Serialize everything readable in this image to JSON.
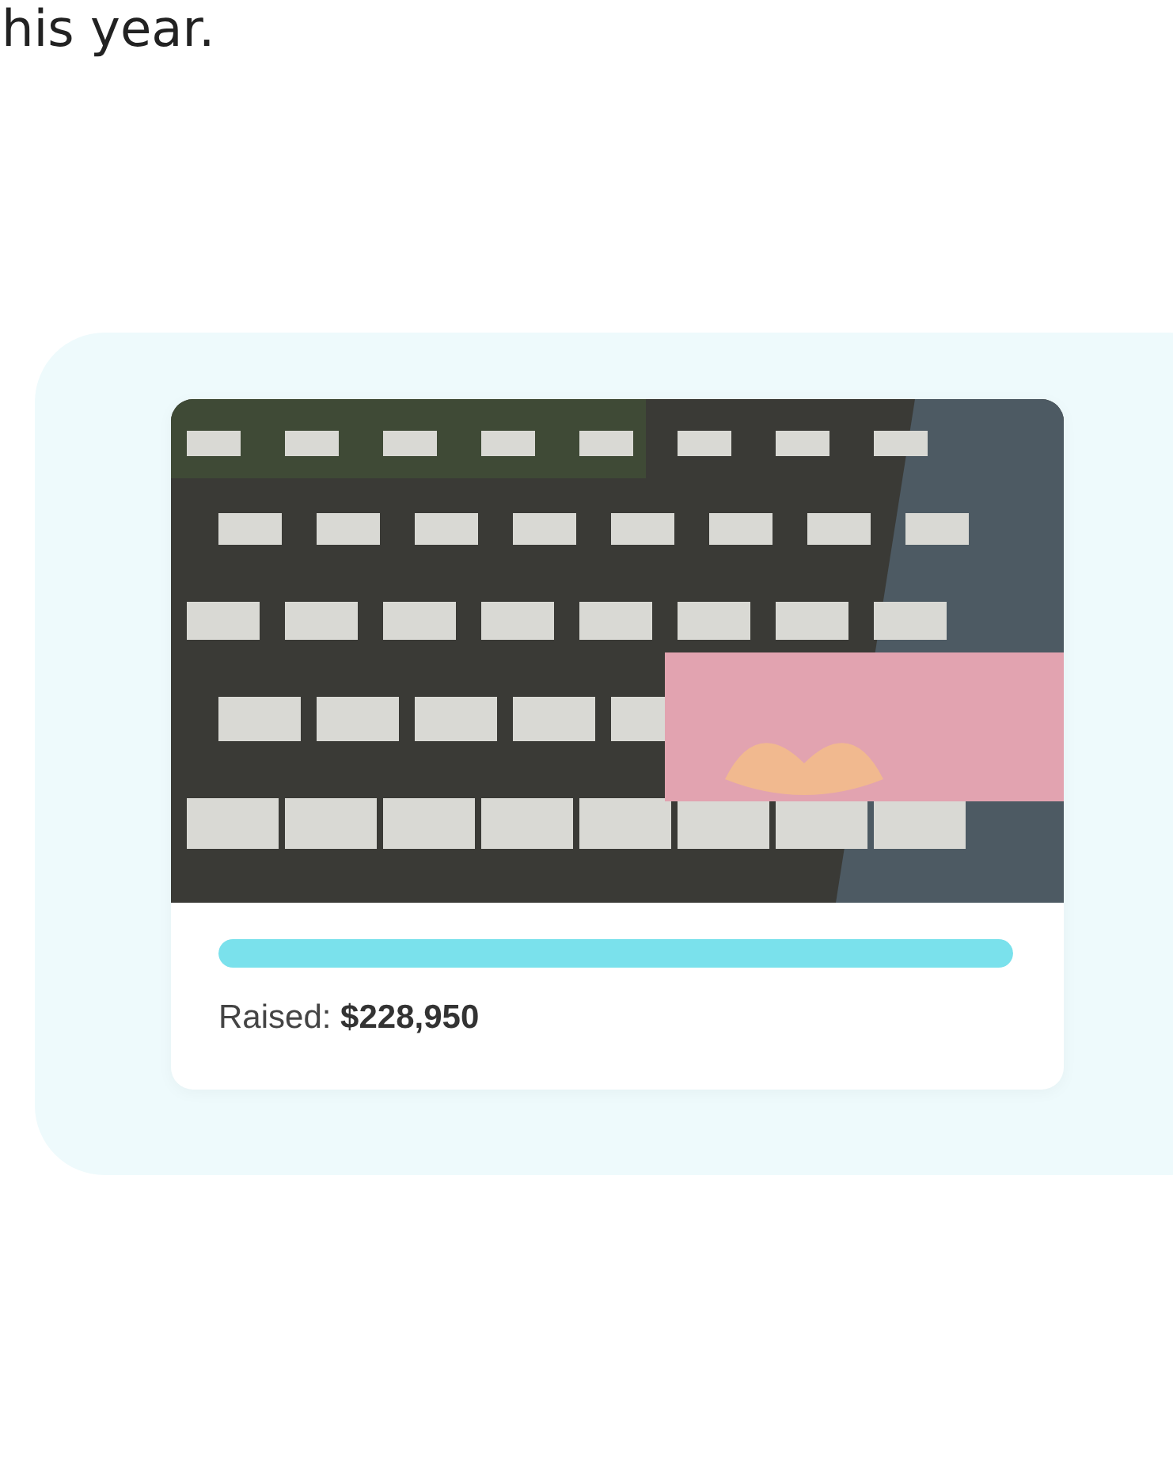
{
  "intro_text": "his year.",
  "campaign_card": {
    "progress": {
      "level": 1
    },
    "raised_label": "Raised: **$228,950**"
  }
}
